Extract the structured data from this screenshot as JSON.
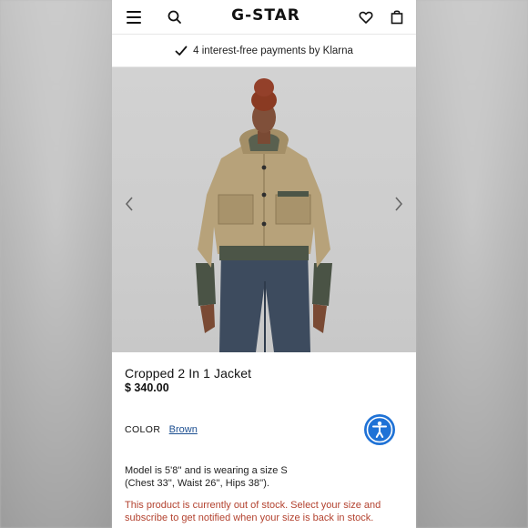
{
  "header": {
    "logo": "G-STAR",
    "icons": [
      "menu-icon",
      "search-icon",
      "heart-icon",
      "shopping-bag-icon"
    ]
  },
  "promo": {
    "text": "4 interest-free payments by Klarna"
  },
  "gallery": {
    "nav": [
      "chevron-left-icon",
      "chevron-right-icon"
    ]
  },
  "product": {
    "title": "Cropped 2 In 1 Jacket",
    "price": "$ 340.00",
    "color_label": "COLOR",
    "color_value": "Brown",
    "model_info_line1": "Model is 5'8'' and is wearing a size S",
    "model_info_line2": "(Chest 33'', Waist 26'', Hips 38'').",
    "stock_line1": "This product is currently out of stock. Select your size and",
    "stock_line2": "subscribe to get notified when your size is back in stock."
  },
  "colors": {
    "link": "#1d4f91",
    "accessibility": "#1f72d6",
    "alert": "#b3422f"
  }
}
